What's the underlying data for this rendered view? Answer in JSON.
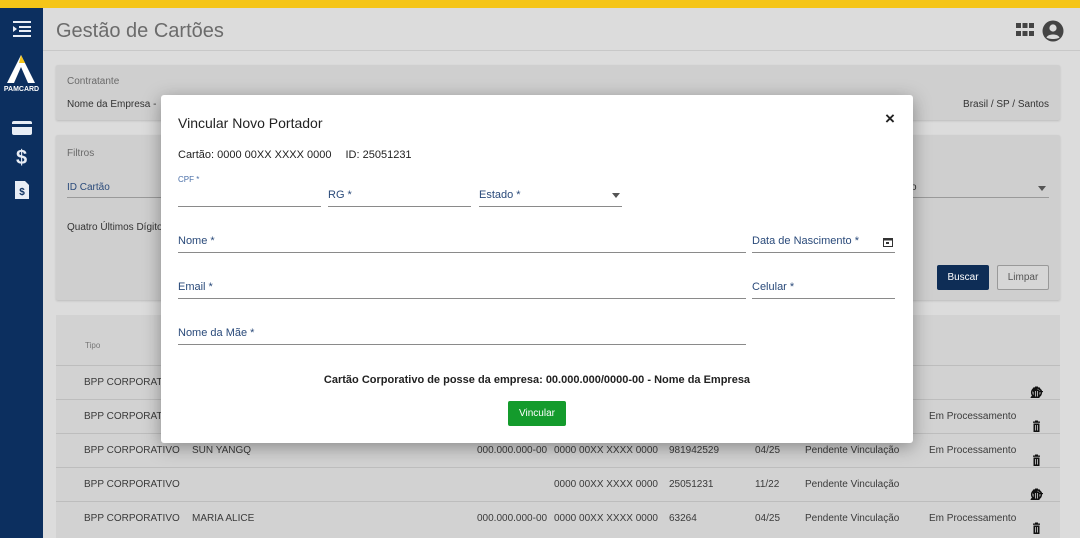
{
  "colors": {
    "accent_yellow": "#f5c518",
    "sidebar_bg": "#0c2f5f",
    "primary_button": "#0e2d56",
    "success_button": "#149b2c"
  },
  "sidebar": {
    "logo_text": "PAMCARD",
    "icons": [
      "menu-collapse-icon",
      "pamcard-logo",
      "credit-card-icon",
      "dollar-icon",
      "document-dollar-icon"
    ]
  },
  "header": {
    "title": "Gestão de Cartões",
    "icons": [
      "apps-grid-icon",
      "account-circle-icon"
    ]
  },
  "contract_card": {
    "label": "Contratante",
    "company": "Nome da Empresa  -",
    "location": "Brasil / SP / Santos"
  },
  "filters_card": {
    "label": "Filtros",
    "id_cartao_label": "ID Cartão",
    "quatro_ultimos_label": "Quatro Últimos Dígito",
    "partial_select_text": "o",
    "search_button": "Buscar",
    "clear_button": "Limpar"
  },
  "table": {
    "header_tipo": "Tipo",
    "rows": [
      {
        "tipo": "BPP CORPORATIVO",
        "nome": "",
        "cpf": "",
        "cartao": "",
        "id": "",
        "validade": "",
        "situacao": "",
        "status": "",
        "actions": [
          "add-person-icon",
          "block-icon",
          "delete-icon"
        ]
      },
      {
        "tipo": "BPP CORPORATIVO",
        "nome": "",
        "cpf": "",
        "cartao": "",
        "id": "",
        "validade": "",
        "situacao": "",
        "status": "Em Processamento",
        "actions": [
          "delete-icon"
        ]
      },
      {
        "tipo": "BPP CORPORATIVO",
        "nome": "SUN YANGQ",
        "cpf": "000.000.000-00",
        "cartao": "0000 00XX XXXX 0000",
        "id": "981942529",
        "validade": "04/25",
        "situacao": "Pendente Vinculação",
        "status": "Em Processamento",
        "actions": [
          "delete-icon"
        ]
      },
      {
        "tipo": "BPP CORPORATIVO",
        "nome": "",
        "cpf": "",
        "cartao": "0000 00XX XXXX 0000",
        "id": "25051231",
        "validade": "11/22",
        "situacao": "Pendente Vinculação",
        "status": "",
        "actions": [
          "add-person-icon",
          "block-icon",
          "delete-icon"
        ]
      },
      {
        "tipo": "BPP CORPORATIVO",
        "nome": "MARIA ALICE",
        "cpf": "000.000.000-00",
        "cartao": "0000 00XX XXXX 0000",
        "id": "63264",
        "validade": "04/25",
        "situacao": "Pendente Vinculação",
        "status": "Em Processamento",
        "actions": [
          "delete-icon"
        ]
      }
    ]
  },
  "modal": {
    "title": "Vincular Novo Portador",
    "close": "×",
    "card_number_text": "Cartão: 0000 00XX XXXX 0000",
    "card_id_text": "ID: 25051231",
    "fields": {
      "cpf": {
        "label": "CPF *",
        "value": ""
      },
      "rg": {
        "label": "RG *",
        "value": ""
      },
      "estado": {
        "label": "Estado *",
        "value": ""
      },
      "nome": {
        "label": "Nome *",
        "value": ""
      },
      "nascimento": {
        "label": "Data de Nascimento *",
        "value": ""
      },
      "email": {
        "label": "Email *",
        "value": ""
      },
      "celular": {
        "label": "Celular *",
        "value": ""
      },
      "mae": {
        "label": "Nome da Mãe *",
        "value": ""
      }
    },
    "owner_text": "Cartão Corporativo de posse da empresa: 00.000.000/0000-00 - Nome da Empresa",
    "submit_button": "Vincular"
  }
}
